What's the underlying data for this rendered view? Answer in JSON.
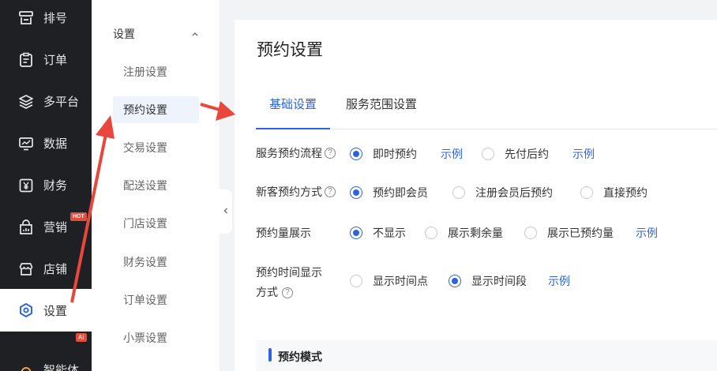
{
  "nav": {
    "items": [
      {
        "label": "排号",
        "icon": "queue-icon"
      },
      {
        "label": "订单",
        "icon": "clipboard-icon"
      },
      {
        "label": "多平台",
        "icon": "layers-icon"
      },
      {
        "label": "数据",
        "icon": "chart-monitor-icon"
      },
      {
        "label": "财务",
        "icon": "yen-icon"
      },
      {
        "label": "营销",
        "icon": "shop-bag-icon",
        "badge": "HOT"
      },
      {
        "label": "店铺",
        "icon": "store-icon"
      },
      {
        "label": "设置",
        "icon": "settings-hex-icon",
        "active": true
      },
      {
        "label": "智能体",
        "icon": "ai-icon",
        "badge": "AI"
      }
    ]
  },
  "submenu": {
    "header": "设置",
    "items": [
      "注册设置",
      "预约设置",
      "交易设置",
      "配送设置",
      "门店设置",
      "财务设置",
      "订单设置",
      "小票设置"
    ],
    "active": "预约设置"
  },
  "main": {
    "title": "预约设置",
    "tabs": [
      {
        "label": "基础设置",
        "active": true
      },
      {
        "label": "服务范围设置",
        "active": false
      }
    ],
    "settings": [
      {
        "label": "服务预约流程",
        "help": "?",
        "options": [
          "即时预约",
          "先付后约"
        ],
        "selected": "即时预约",
        "links": [
          "示例",
          "示例"
        ]
      },
      {
        "label": "新客预约方式",
        "help": "?",
        "options": [
          "预约即会员",
          "注册会员后预约",
          "直接预约"
        ],
        "selected": "预约即会员"
      },
      {
        "label": "预约量展示",
        "options": [
          "不显示",
          "展示剩余量",
          "展示已预约量"
        ],
        "selected": "不显示",
        "links": [
          "示例"
        ]
      },
      {
        "label_line1": "预约时间显示",
        "label_line2": "方式",
        "help": "?",
        "options": [
          "显示时间点",
          "显示时间段"
        ],
        "selected": "显示时间段",
        "links": [
          "示例"
        ]
      }
    ],
    "section": "预约模式"
  },
  "colors": {
    "accent": "#2d63e0",
    "nav_bg": "#1f2024",
    "arrow": "#e8473b"
  }
}
